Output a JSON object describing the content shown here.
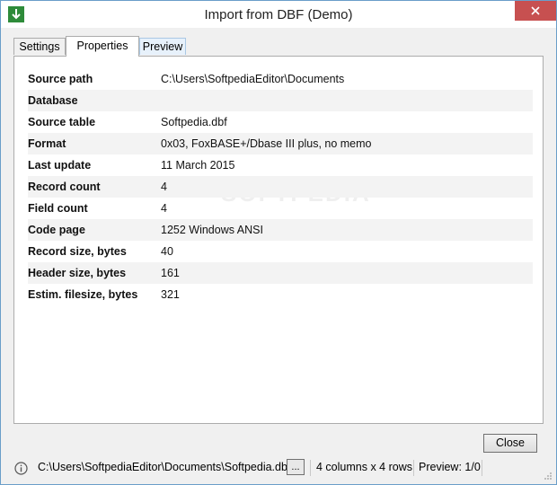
{
  "window": {
    "title": "Import from DBF (Demo)"
  },
  "tabs": [
    {
      "label": "Settings"
    },
    {
      "label": "Properties"
    },
    {
      "label": "Preview"
    }
  ],
  "properties": [
    {
      "key": "Source path",
      "value": "C:\\Users\\SoftpediaEditor\\Documents"
    },
    {
      "key": "Database",
      "value": ""
    },
    {
      "key": "Source table",
      "value": "Softpedia.dbf"
    },
    {
      "key": "Format",
      "value": "0x03, FoxBASE+/Dbase III plus, no memo"
    },
    {
      "key": "Last update",
      "value": "11 March 2015"
    },
    {
      "key": "Record count",
      "value": "4"
    },
    {
      "key": "Field count",
      "value": "4"
    },
    {
      "key": "Code page",
      "value": "1252 Windows ANSI"
    },
    {
      "key": "Record size, bytes",
      "value": "40"
    },
    {
      "key": "Header size, bytes",
      "value": "161"
    },
    {
      "key": "Estim. filesize, bytes",
      "value": "321"
    }
  ],
  "watermark": "SOFTPEDIA",
  "buttons": {
    "close_label": "Close",
    "browse_label": "..."
  },
  "status": {
    "path": "C:\\Users\\SoftpediaEditor\\Documents\\Softpedia.dbf",
    "columns_rows": "4 columns x 4 rows",
    "preview": "Preview: 1/0"
  },
  "icons": {
    "app": "down-arrow-icon",
    "info": "info-icon",
    "close": "close-icon",
    "grip": "resize-grip-icon"
  },
  "colors": {
    "close_button_bg": "#c75050",
    "app_icon_bg": "#2e8b3a",
    "window_border": "#6a9ec9"
  }
}
